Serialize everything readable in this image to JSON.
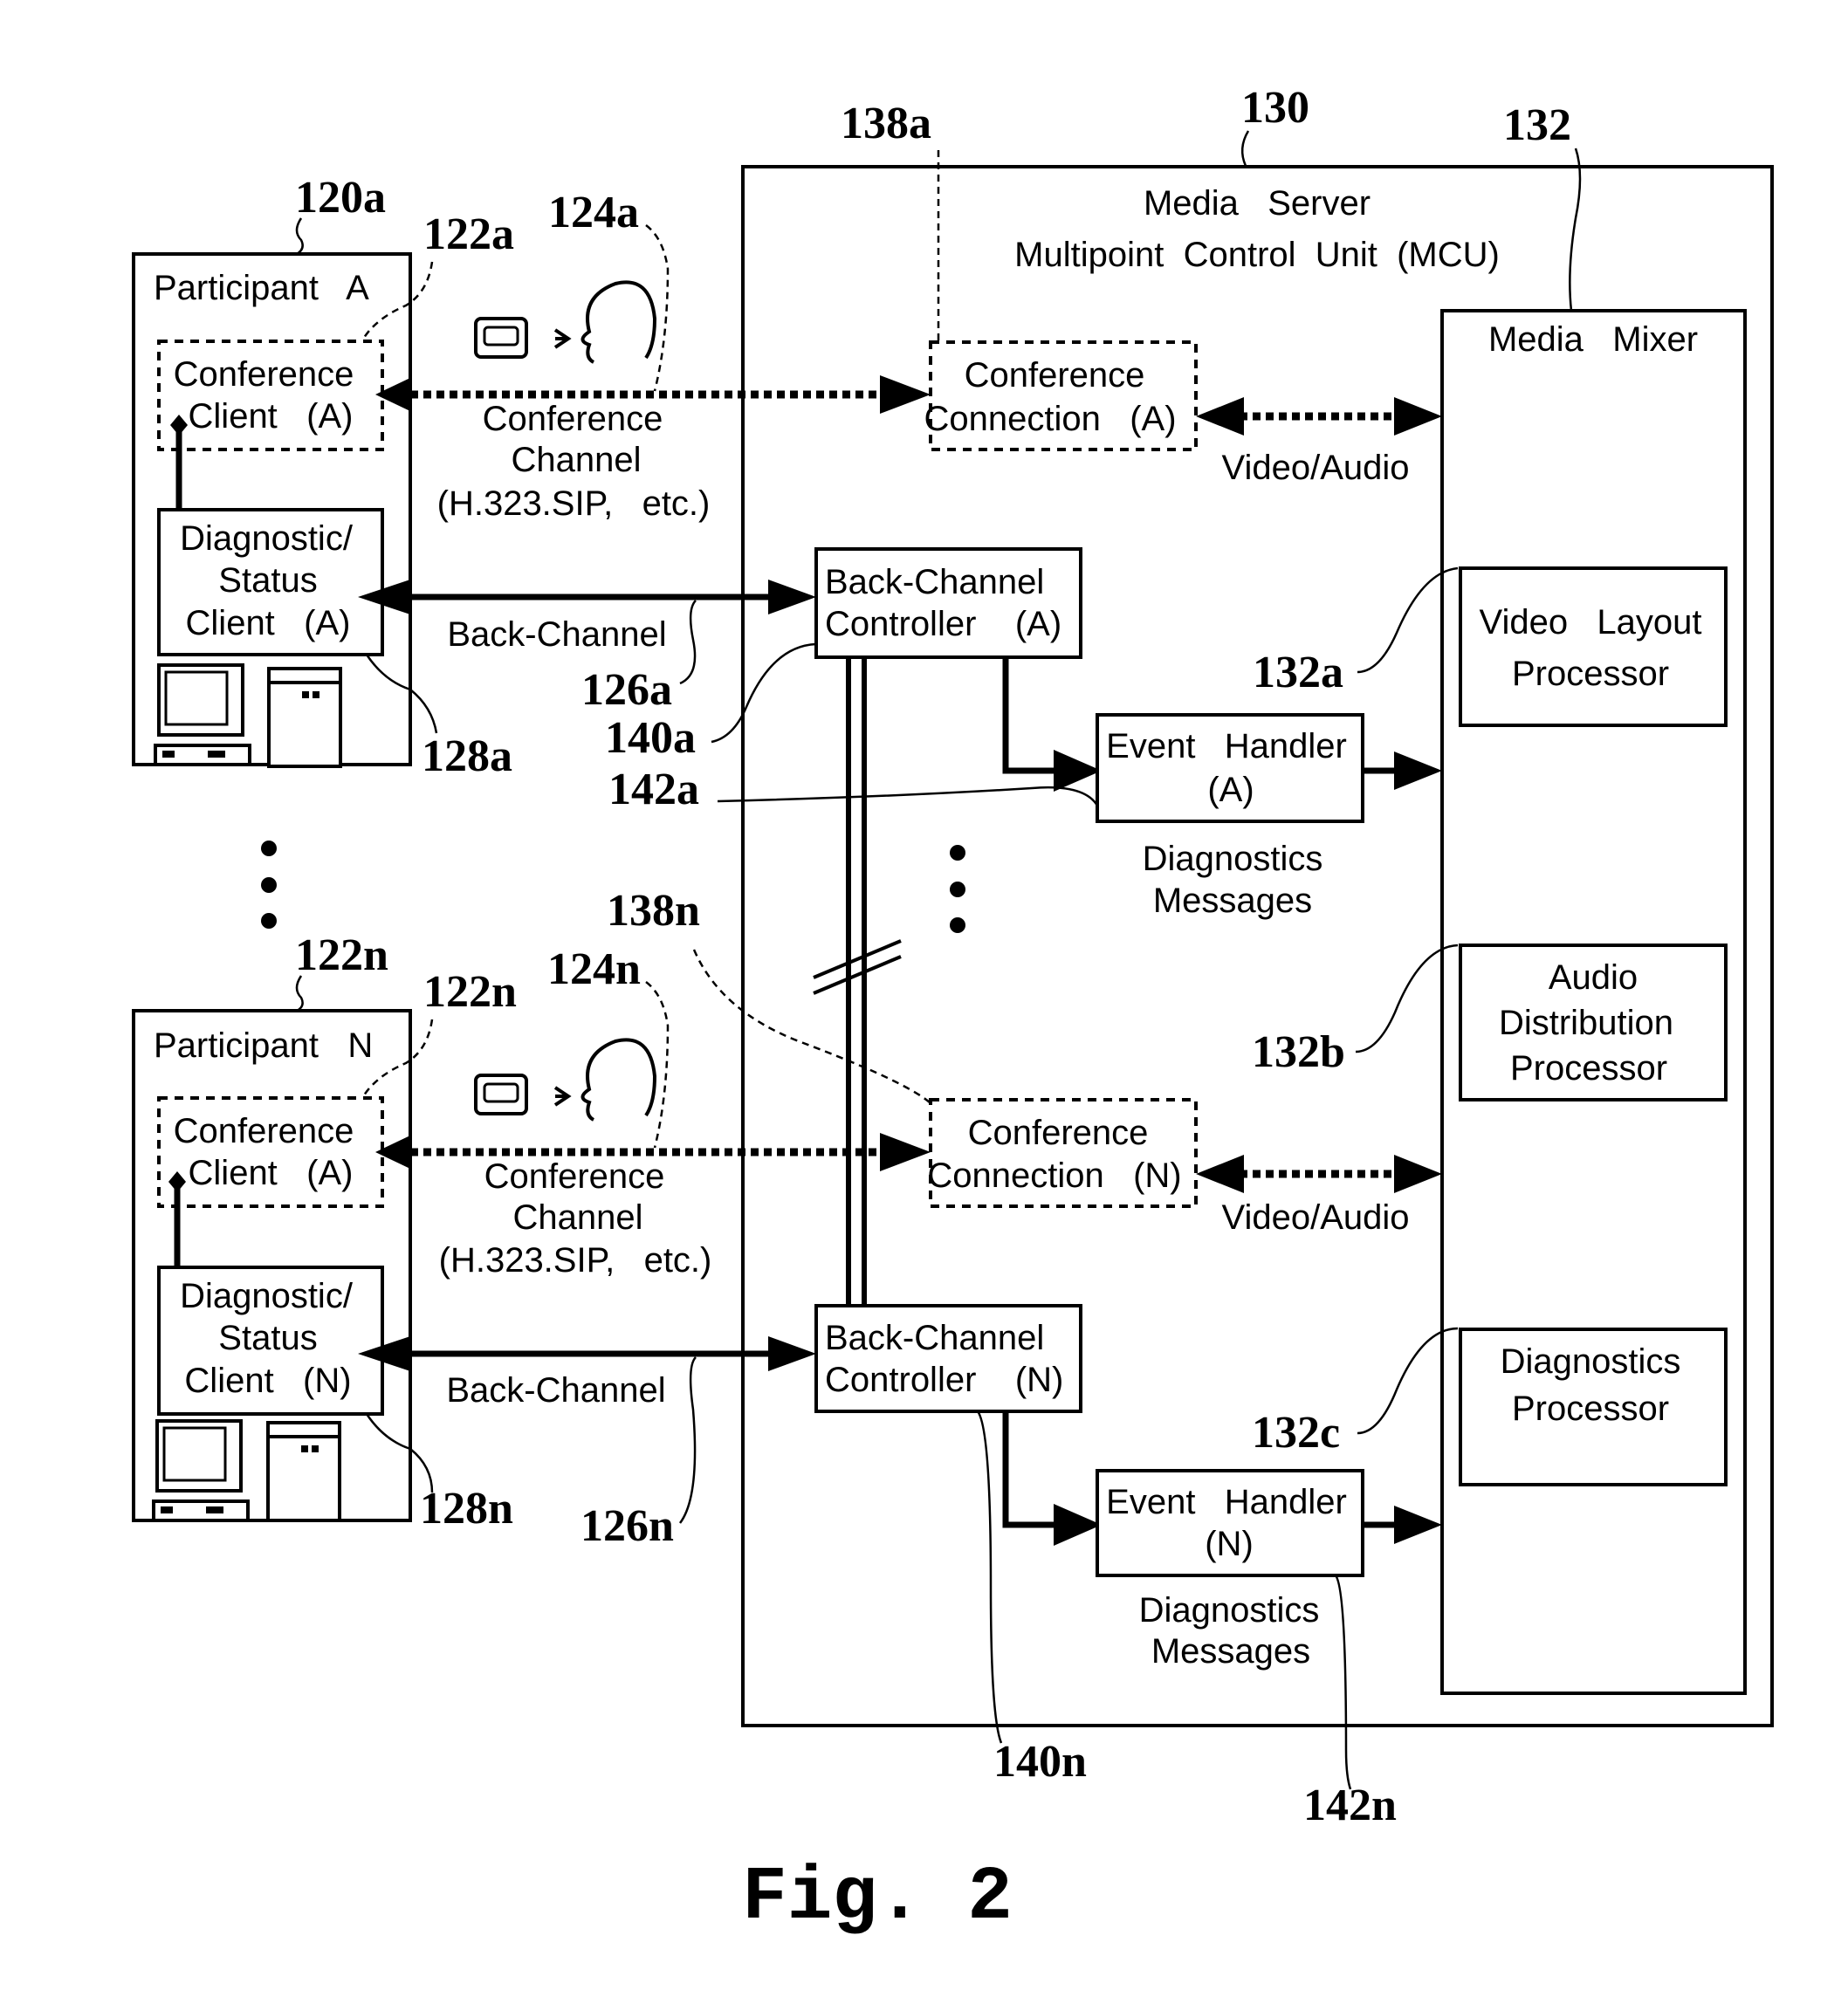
{
  "figure": {
    "caption": "Fig. 2"
  },
  "participants": [
    {
      "ref": "120a",
      "title": "Participant   A",
      "conf_client_ref": "122a",
      "conf_client_lines": [
        "Conference",
        "Client   (A)"
      ],
      "diag_client_lines": [
        "Diagnostic/",
        "Status",
        "Client   (A)"
      ],
      "diag_ref": "128a",
      "media_ref": "124a",
      "conf_channel_lines": [
        "Conference",
        "Channel",
        "(H.323.SIP,   etc.)"
      ],
      "back_channel_label": "Back-Channel",
      "back_channel_ref": "126a"
    },
    {
      "ref": "122n",
      "title": "Participant   N",
      "conf_client_ref": "122n",
      "conf_client_lines": [
        "Conference",
        "Client   (A)"
      ],
      "diag_client_lines": [
        "Diagnostic/",
        "Status",
        "Client   (N)"
      ],
      "diag_ref": "128n",
      "media_ref": "124n",
      "conf_channel_lines": [
        "Conference",
        "Channel",
        "(H.323.SIP,   etc.)"
      ],
      "back_channel_label": "Back-Channel",
      "back_channel_ref": "126n"
    }
  ],
  "server": {
    "ref": "130",
    "title_lines": [
      "Media   Server",
      "Multipoint  Control  Unit  (MCU)"
    ],
    "conf_connections": [
      {
        "ref": "138a",
        "lines": [
          "Conference",
          "Connection   (A)"
        ],
        "link_label": "Video/Audio"
      },
      {
        "ref": "138n",
        "lines": [
          "Conference",
          "Connection   (N)"
        ],
        "link_label": "Video/Audio"
      }
    ],
    "back_channel_controllers": [
      {
        "ref": "140a",
        "lines": [
          "Back-Channel",
          "Controller    (A)"
        ]
      },
      {
        "ref": "140n",
        "lines": [
          "Back-Channel",
          "Controller    (N)"
        ]
      }
    ],
    "event_handlers": [
      {
        "ref": "142a",
        "lines": [
          "Event   Handler",
          "(A)"
        ],
        "msg_lines": [
          "Diagnostics",
          "Messages"
        ]
      },
      {
        "ref": "142n",
        "lines": [
          "Event   Handler",
          "(N)"
        ],
        "msg_lines": [
          "Diagnostics",
          "Messages"
        ]
      }
    ],
    "media_mixer": {
      "ref": "132",
      "title": "Media   Mixer",
      "processors": [
        {
          "ref": "132a",
          "lines": [
            "Video   Layout",
            "Processor"
          ]
        },
        {
          "ref": "132b",
          "lines": [
            "Audio",
            "Distribution",
            "Processor"
          ]
        },
        {
          "ref": "132c",
          "lines": [
            "Diagnostics",
            "Processor"
          ]
        }
      ]
    }
  }
}
